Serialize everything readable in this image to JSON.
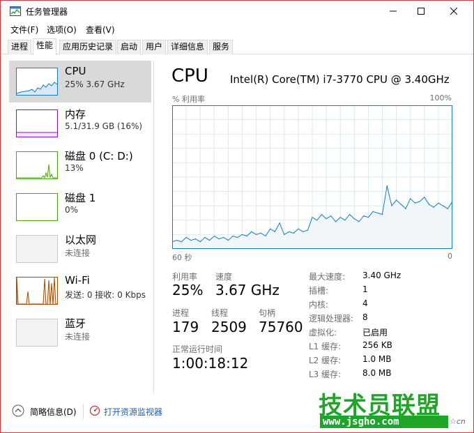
{
  "window": {
    "title": "任务管理器",
    "controls": {
      "minimize": "—",
      "maximize": "☐",
      "close": "✕"
    }
  },
  "menu": [
    "文件(F)",
    "选项(O)",
    "查看(V)"
  ],
  "tabs": [
    {
      "label": "进程",
      "active": false
    },
    {
      "label": "性能",
      "active": true
    },
    {
      "label": "应用历史记录",
      "active": false
    },
    {
      "label": "启动",
      "active": false
    },
    {
      "label": "用户",
      "active": false
    },
    {
      "label": "详细信息",
      "active": false
    },
    {
      "label": "服务",
      "active": false
    }
  ],
  "sidebar": {
    "items": [
      {
        "title": "CPU",
        "sub": "25%  3.67 GHz",
        "color": "#117dbb",
        "active": true
      },
      {
        "title": "内存",
        "sub": "5.1/31.9 GB (16%)",
        "color": "#8b12ae",
        "active": false
      },
      {
        "title": "磁盘 0 (C: D:)",
        "sub": "13%",
        "color": "#4da60c",
        "active": false
      },
      {
        "title": "磁盘 1",
        "sub": "0%",
        "color": "#4da60c",
        "active": false
      },
      {
        "title": "以太网",
        "sub": "未连接",
        "color": "#a7a7a7",
        "active": false
      },
      {
        "title": "Wi-Fi",
        "sub": "发送: 0 接收: 0 Kbps",
        "color": "#a74f01",
        "active": false
      },
      {
        "title": "蓝牙",
        "sub": "未连接",
        "color": "#a7a7a7",
        "active": false
      }
    ]
  },
  "main": {
    "title": "CPU",
    "cpu_name": "Intel(R) Core(TM) i7-3770 CPU @ 3.40GHz",
    "graph_label_left": "% 利用率",
    "graph_label_right": "100%",
    "axis_left": "60 秒",
    "axis_right": "0",
    "stats": {
      "utilization_label": "利用率",
      "utilization": "25%",
      "speed_label": "速度",
      "speed": "3.67 GHz",
      "processes_label": "进程",
      "processes": "179",
      "threads_label": "线程",
      "threads": "2509",
      "handles_label": "句柄",
      "handles": "75760",
      "uptime_label": "正常运行时间",
      "uptime": "1:00:18:12"
    },
    "specs": [
      {
        "label": "最大速度:",
        "value": "3.40 GHz"
      },
      {
        "label": "插槽:",
        "value": "1"
      },
      {
        "label": "内核:",
        "value": "4"
      },
      {
        "label": "逻辑处理器:",
        "value": "8"
      },
      {
        "label": "虚拟化:",
        "value": "已启用"
      },
      {
        "label": "L1 缓存:",
        "value": "256 KB"
      },
      {
        "label": "L2 缓存:",
        "value": "1.0 MB"
      },
      {
        "label": "L3 缓存:",
        "value": "8.0 MB"
      }
    ]
  },
  "footer": {
    "collapse": "简略信息(D)",
    "open_monitor": "打开资源监视器"
  },
  "watermark": {
    "name": "技术员联盟",
    "url": "www.jsgho.com",
    "suffix": "☆cn"
  },
  "chart_data": {
    "type": "area",
    "ylim": [
      0,
      100
    ],
    "x": [
      0,
      1,
      2,
      3,
      4,
      5,
      6,
      7,
      8,
      9,
      10,
      11,
      12,
      13,
      14,
      15,
      16,
      17,
      18,
      19,
      20,
      21,
      22,
      23,
      24,
      25,
      26,
      27,
      28,
      29,
      30,
      31,
      32,
      33,
      34,
      35,
      36,
      37,
      38,
      39,
      40,
      41,
      42,
      43,
      44,
      45,
      46,
      47,
      48,
      49,
      50,
      51,
      52,
      53,
      54,
      55,
      56,
      57,
      58,
      59,
      60
    ],
    "values": [
      5,
      6,
      5,
      8,
      6,
      7,
      5,
      8,
      6,
      9,
      7,
      8,
      6,
      9,
      8,
      10,
      9,
      12,
      10,
      11,
      9,
      14,
      12,
      18,
      10,
      12,
      11,
      14,
      12,
      13,
      22,
      20,
      24,
      21,
      23,
      19,
      22,
      20,
      24,
      21,
      19,
      23,
      22,
      26,
      25,
      24,
      44,
      30,
      34,
      31,
      28,
      35,
      32,
      33,
      36,
      31,
      29,
      32,
      30,
      28,
      33
    ],
    "series_color": "#117dbb",
    "fill_color": "#f1f6fa",
    "grid": true
  }
}
